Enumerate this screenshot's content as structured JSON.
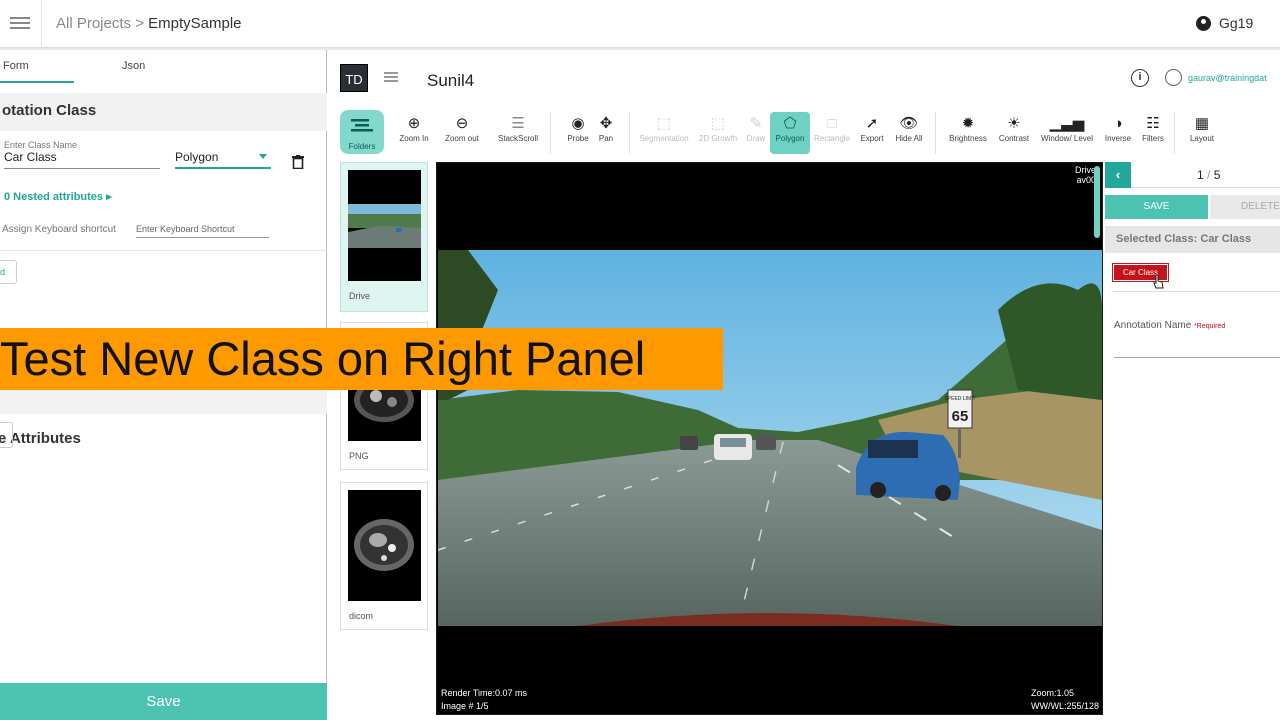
{
  "topbar": {
    "breadcrumb_root": "All Projects",
    "breadcrumb_sep": " > ",
    "breadcrumb_current": "EmptySample",
    "user_name": "Gg19"
  },
  "left_panel": {
    "tabs": [
      "Form",
      "Json"
    ],
    "section_title": "otation Class",
    "class_name_label": "Enter Class Name",
    "class_name_value": "Car Class",
    "annotation_type": "Polygon",
    "nested_attributes": "0 Nested attributes ▸",
    "keyboard_label": "Assign Keyboard shortcut",
    "keyboard_placeholder": "Enter Keyboard Shortcut",
    "stub_button": "d",
    "section2_title": "e Attributes",
    "save_label": "Save"
  },
  "banner": {
    "text": "Test New Class on Right Panel"
  },
  "viewer": {
    "logo": "TD",
    "project_name": "Sunil4",
    "user_email": "gaurav@trainingdat",
    "toolbar": [
      {
        "label": "Folders",
        "icon": "folders-icon",
        "state": "active"
      },
      {
        "label": "Zoom In",
        "icon": "zoom-in-icon",
        "state": "normal"
      },
      {
        "label": "Zoom out",
        "icon": "zoom-out-icon",
        "state": "normal"
      },
      {
        "label": "StackScroll",
        "icon": "stackscroll-icon",
        "state": "normal"
      },
      {
        "label": "Probe",
        "icon": "probe-icon",
        "state": "normal"
      },
      {
        "label": "Pan",
        "icon": "pan-icon",
        "state": "normal"
      },
      {
        "label": "Segmentation",
        "icon": "segmentation-icon",
        "state": "disabled"
      },
      {
        "label": "2D Growth",
        "icon": "growth-icon",
        "state": "disabled"
      },
      {
        "label": "Draw",
        "icon": "draw-icon",
        "state": "disabled"
      },
      {
        "label": "Polygon",
        "icon": "polygon-icon",
        "state": "active"
      },
      {
        "label": "Rectangle",
        "icon": "rectangle-icon",
        "state": "disabled"
      },
      {
        "label": "Export",
        "icon": "export-icon",
        "state": "normal"
      },
      {
        "label": "Hide All",
        "icon": "eye-icon",
        "state": "normal"
      },
      {
        "label": "Brightness",
        "icon": "brightness-icon",
        "state": "normal"
      },
      {
        "label": "Contrast",
        "icon": "contrast-icon",
        "state": "normal"
      },
      {
        "label": "Window/ Level",
        "icon": "window-level-icon",
        "state": "normal"
      },
      {
        "label": "Inverse",
        "icon": "inverse-icon",
        "state": "normal"
      },
      {
        "label": "Filters",
        "icon": "filters-icon",
        "state": "normal"
      },
      {
        "label": "Layout",
        "icon": "layout-icon",
        "state": "normal"
      }
    ],
    "thumbnails": [
      {
        "caption": "Drive",
        "selected": true
      },
      {
        "caption": "PNG",
        "selected": false
      },
      {
        "caption": "dicom",
        "selected": false
      }
    ],
    "overlay": {
      "top_right_1": "Drive",
      "top_right_2": "av00",
      "render_time": "Render Time:0.07 ms",
      "image_index": "Image # 1/5",
      "zoom": "Zoom:1.05",
      "wwwl": "WW/WL:255/128",
      "speed_sign_top": "SPEED LIMIT",
      "speed_sign_value": "65"
    }
  },
  "right_panel": {
    "page_current": "1",
    "page_sep": " / ",
    "page_total": "5",
    "save_label": "SAVE",
    "delete_label": "DELETE",
    "selected_class": "Selected Class: Car Class",
    "class_chip": "Car Class",
    "annotation_name_label": "Annotation Name ",
    "required_label": "*Required"
  },
  "colors": {
    "accent": "#21a89b",
    "accent_light": "#4cc2b3",
    "banner": "#fe9900",
    "chip": "#c4131a"
  }
}
